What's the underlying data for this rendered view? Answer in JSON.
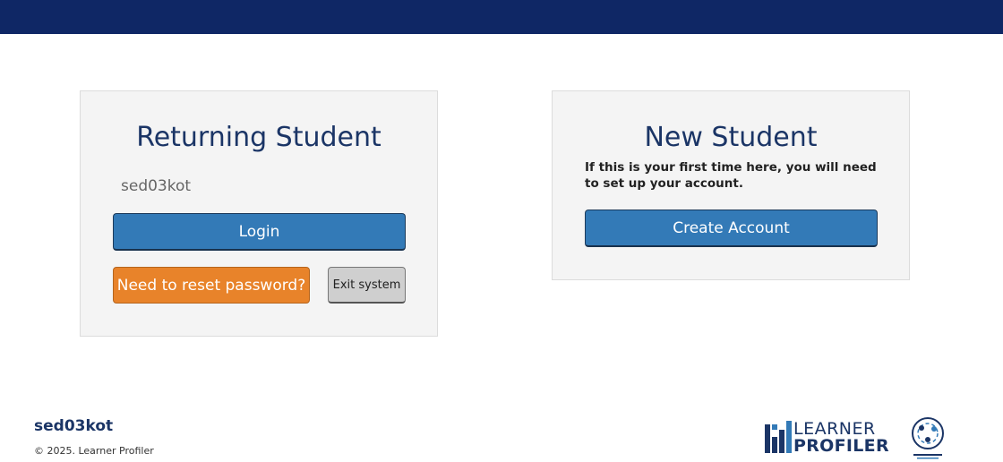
{
  "returning": {
    "title": "Returning Student",
    "username": "sed03kot",
    "login_label": "Login",
    "reset_label": "Need to reset password?",
    "exit_label": "Exit system"
  },
  "new_student": {
    "title": "New Student",
    "description": "If this is your first time here, you will need to set up your account.",
    "create_label": "Create Account"
  },
  "footer": {
    "username": "sed03kot",
    "copyright": "© 2025. Learner Profiler"
  },
  "logo": {
    "line1": "LEARNER",
    "line2": "PROFILER"
  },
  "colors": {
    "topbar": "#0f2765",
    "primary": "#337ab7",
    "warning": "#e8832a",
    "title": "#1b3566"
  }
}
